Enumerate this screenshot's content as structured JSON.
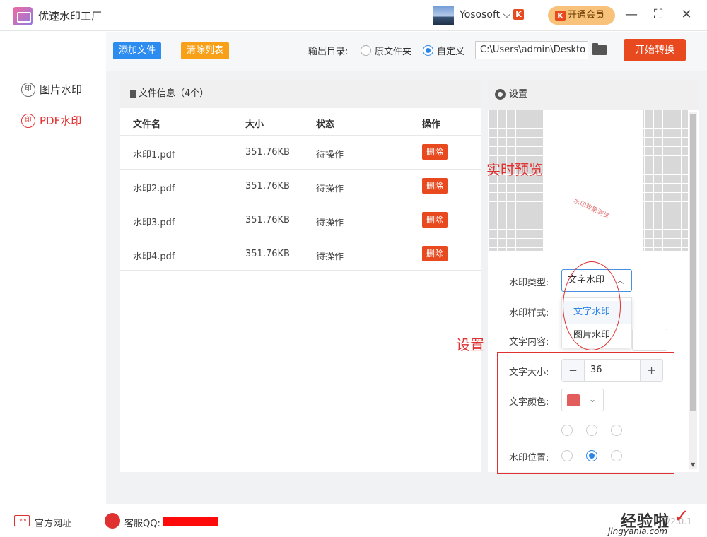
{
  "titlebar": {
    "app_title": "优速水印工厂",
    "user_name": "Yososoft",
    "user_chevron": "⌵",
    "vip_label": "开通会员",
    "vip_icon_glyph": "K",
    "minimize": "—",
    "maximize": "⛶",
    "close": "✕"
  },
  "sidebar": {
    "items": [
      {
        "label": "图片水印",
        "icon_glyph": "印",
        "active": false
      },
      {
        "label": "PDF水印",
        "icon_glyph": "印",
        "active": true
      }
    ]
  },
  "toolbar": {
    "add_file": "添加文件",
    "clear_list": "清除列表",
    "output_label": "输出目录:",
    "option_original": "原文件夹",
    "option_custom": "自定义",
    "selected_option": "自定义",
    "path_value": "C:\\Users\\admin\\Deskto",
    "start": "开始转换"
  },
  "files": {
    "header": "文件信息（4个）",
    "columns": [
      "文件名",
      "大小",
      "状态",
      "操作"
    ],
    "rows": [
      {
        "name": "水印1.pdf",
        "size": "351.76KB",
        "status": "待操作",
        "action": "删除"
      },
      {
        "name": "水印2.pdf",
        "size": "351.76KB",
        "status": "待操作",
        "action": "删除"
      },
      {
        "name": "水印3.pdf",
        "size": "351.76KB",
        "status": "待操作",
        "action": "删除"
      },
      {
        "name": "水印4.pdf",
        "size": "351.76KB",
        "status": "待操作",
        "action": "删除"
      }
    ]
  },
  "settings": {
    "title": "设置",
    "preview_watermark": "水印效果测试",
    "labels": {
      "type": "水印类型:",
      "style": "水印样式:",
      "content": "文字内容:",
      "size": "文字大小:",
      "color": "文字颜色:",
      "position": "水印位置:"
    },
    "type_value": "文字水印",
    "dropdown_options": [
      "文字水印",
      "图片水印"
    ],
    "selected_dropdown": "文字水印",
    "font_size": "36",
    "minus": "−",
    "plus": "+",
    "color_value": "#e25c5c",
    "position_selected": "middle-center"
  },
  "annotations": {
    "preview_label": "实时预览",
    "settings_label": "设置",
    "color": "#e03030"
  },
  "footer": {
    "website": "官方网址",
    "web_icon_text": "com",
    "support_label": "客服QQ:",
    "version": "V2.0.1",
    "watermark_logo": "经验啦",
    "watermark_check": "✓",
    "watermark_url": "jingyanla.com"
  },
  "colors": {
    "accent_blue": "#2a85e8",
    "add_btn": "#2d8cf0",
    "clear_btn": "#f7a018",
    "primary_red": "#e9491e",
    "active_sidebar": "#e03030"
  }
}
